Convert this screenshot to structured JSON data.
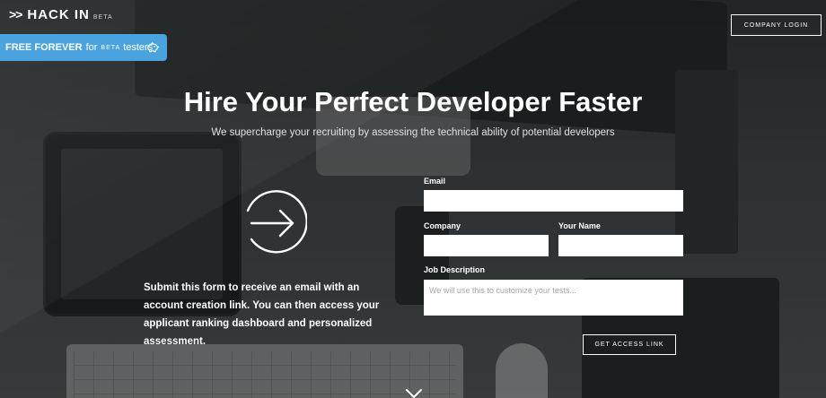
{
  "brand": {
    "chevrons": ">>",
    "name": "HACK IN",
    "tag": "BETA"
  },
  "header": {
    "login_label": "COMPANY LOGIN"
  },
  "promo": {
    "strong": "FREE FOREVER",
    "for": "for",
    "beta": "BETA",
    "rest": "testers",
    "icon": "piggy-bank-icon",
    "color": "#4aa3df"
  },
  "hero": {
    "title": "Hire Your Perfect Developer Faster",
    "subtitle": "We supercharge your recruiting by assessing the technical ability of potential developers"
  },
  "info": {
    "icon": "arrow-right-circle-icon",
    "text": "Submit this form to receive an email with an account creation link. You can then access your applicant ranking dashboard and personalized assessment."
  },
  "form": {
    "email_label": "Email",
    "company_label": "Company",
    "name_label": "Your Name",
    "job_label": "Job Description",
    "job_placeholder": "We will use this to customize your tests...",
    "submit_label": "GET ACCESS LINK"
  },
  "scroll": {
    "icon": "chevron-down-icon"
  }
}
